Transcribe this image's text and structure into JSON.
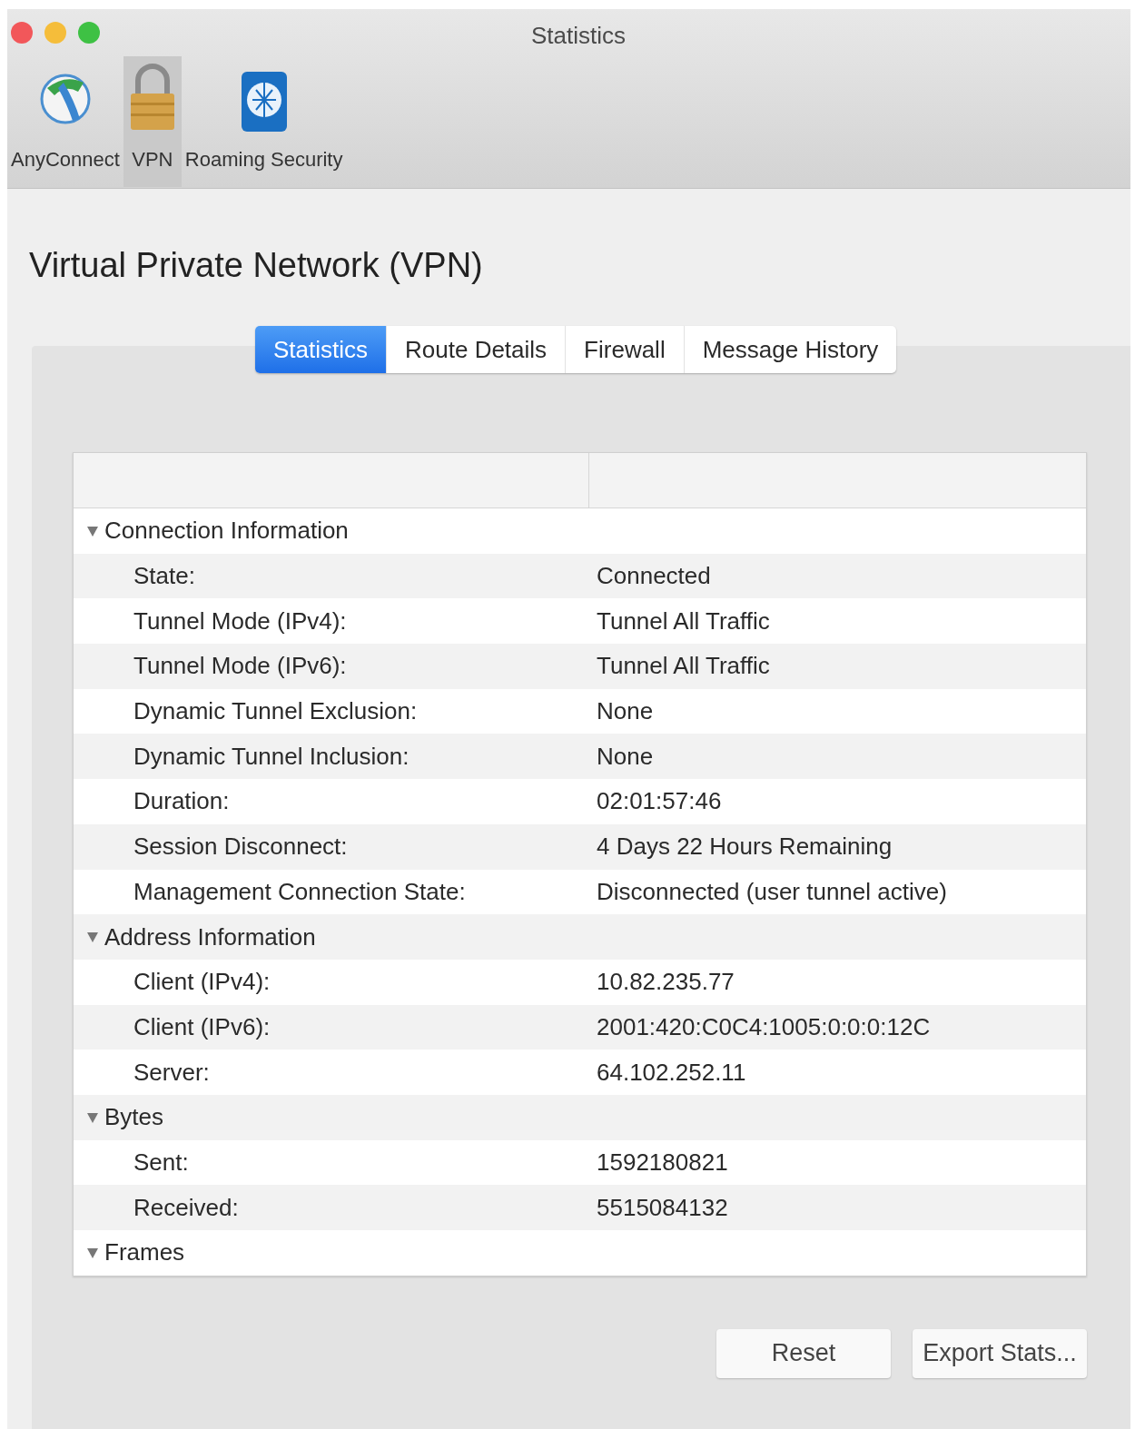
{
  "window": {
    "title": "Statistics"
  },
  "toolbar": [
    {
      "label": "AnyConnect",
      "kind": "globe",
      "selected": false
    },
    {
      "label": "VPN",
      "kind": "lock",
      "selected": true
    },
    {
      "label": "Roaming Security",
      "kind": "shield",
      "selected": false
    }
  ],
  "heading": "Virtual Private Network (VPN)",
  "tabs": [
    {
      "label": "Statistics",
      "selected": true
    },
    {
      "label": "Route Details",
      "selected": false
    },
    {
      "label": "Firewall",
      "selected": false
    },
    {
      "label": "Message History",
      "selected": false
    }
  ],
  "groups": [
    {
      "label": "Connection Information",
      "expanded": true,
      "children": [
        {
          "label": "State:",
          "value": "Connected"
        },
        {
          "label": "Tunnel Mode (IPv4):",
          "value": "Tunnel All Traffic"
        },
        {
          "label": "Tunnel Mode (IPv6):",
          "value": "Tunnel All Traffic"
        },
        {
          "label": "Dynamic Tunnel Exclusion:",
          "value": "None"
        },
        {
          "label": "Dynamic Tunnel Inclusion:",
          "value": "None"
        },
        {
          "label": "Duration:",
          "value": "02:01:57:46"
        },
        {
          "label": "Session Disconnect:",
          "value": "4 Days 22 Hours Remaining"
        },
        {
          "label": "Management Connection State:",
          "value": "Disconnected (user tunnel active)"
        }
      ]
    },
    {
      "label": "Address Information",
      "expanded": true,
      "children": [
        {
          "label": "Client (IPv4):",
          "value": "10.82.235.77"
        },
        {
          "label": "Client (IPv6):",
          "value": "2001:420:C0C4:1005:0:0:0:12C"
        },
        {
          "label": "Server:",
          "value": "64.102.252.11"
        }
      ]
    },
    {
      "label": "Bytes",
      "expanded": true,
      "children": [
        {
          "label": "Sent:",
          "value": "1592180821"
        },
        {
          "label": "Received:",
          "value": "5515084132"
        }
      ]
    },
    {
      "label": "Frames",
      "expanded": true
    }
  ],
  "buttons": [
    "Reset",
    "Export Stats..."
  ]
}
